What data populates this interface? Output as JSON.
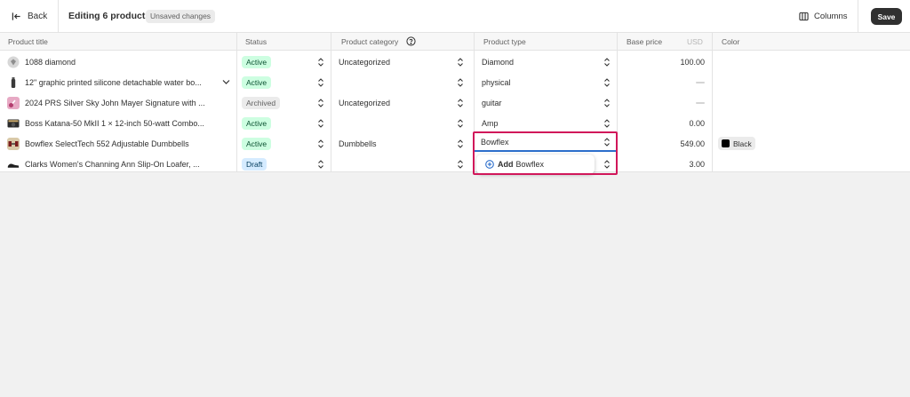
{
  "header": {
    "back_label": "Back",
    "title": "Editing 6 products",
    "unsaved_badge": "Unsaved changes",
    "columns_label": "Columns",
    "save_label": "Save"
  },
  "table": {
    "columns": {
      "title": "Product title",
      "status": "Status",
      "category": "Product category",
      "type": "Product type",
      "price": "Base price",
      "currency": "USD",
      "color": "Color"
    },
    "rows": [
      {
        "title": "1088 diamond",
        "status": "Active",
        "category": "Uncategorized",
        "type": "Diamond",
        "price": "100.00",
        "color": ""
      },
      {
        "title": "12\" graphic printed silicone detachable water bo...",
        "status": "Active",
        "category": "",
        "type": "physical",
        "price": "",
        "color": ""
      },
      {
        "title": "2024 PRS Silver Sky John Mayer Signature with ...",
        "status": "Archived",
        "category": "Uncategorized",
        "type": "guitar",
        "price": "",
        "color": ""
      },
      {
        "title": "Boss Katana-50 MkII 1 × 12-inch 50-watt Combo...",
        "status": "Active",
        "category": "",
        "type": "Amp",
        "price": "0.00",
        "color": ""
      },
      {
        "title": "Bowflex SelectTech 552 Adjustable Dumbbells",
        "status": "Active",
        "category": "Dumbbells",
        "type": "Bowflex",
        "price": "549.00",
        "color": "Black"
      },
      {
        "title": "Clarks Women's Channing Ann Slip-On Loafer, ...",
        "status": "Draft",
        "category": "",
        "type": "",
        "price": "3.00",
        "color": ""
      }
    ]
  },
  "dropdown": {
    "add_label": "Add",
    "add_value": "Bowflex"
  },
  "colors": {
    "focus_outline": "#d1175a",
    "input_underline": "#2c6ecb",
    "save_button": "#303030"
  }
}
